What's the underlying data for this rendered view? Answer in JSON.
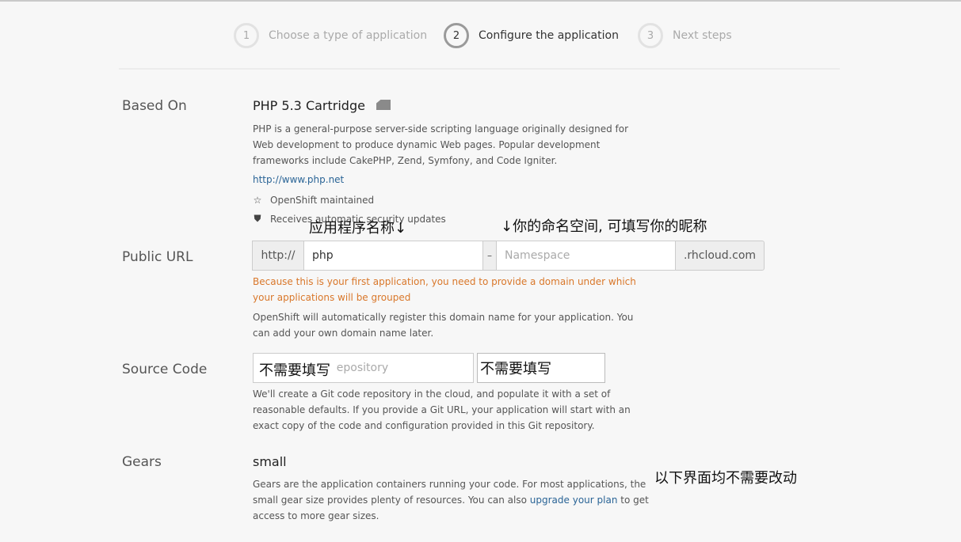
{
  "steps": [
    {
      "num": "1",
      "label": "Choose a type of application"
    },
    {
      "num": "2",
      "label": "Configure the application"
    },
    {
      "num": "3",
      "label": "Next steps"
    }
  ],
  "based_on": {
    "label": "Based On",
    "title": "PHP 5.3 Cartridge",
    "description": "PHP is a general-purpose server-side scripting language originally designed for Web development to produce dynamic Web pages. Popular development frameworks include CakePHP, Zend, Symfony, and Code Igniter.",
    "link": "http://www.php.net",
    "features": [
      "OpenShift maintained",
      "Receives automatic security updates"
    ],
    "icons": {
      "cartridge": "cartridge-icon",
      "maintained": "star-outline-icon",
      "security": "shield-icon"
    }
  },
  "public_url": {
    "label": "Public URL",
    "prefix": "http://",
    "app_name_value": "php",
    "separator": "–",
    "namespace_placeholder": "Namespace",
    "suffix": ".rhcloud.com",
    "warning": "Because this is your first application, you need to provide a domain under which your applications will be grouped",
    "help": "OpenShift will automatically register this domain name for your application. You can add your own domain name later."
  },
  "source_code": {
    "label": "Source Code",
    "repo_placeholder": "Link to a Git repository",
    "help": "We'll create a Git code repository in the cloud, and populate it with a set of reasonable defaults. If you provide a Git URL, your application will start with an exact copy of the code and configuration provided in this Git repository."
  },
  "gears": {
    "label": "Gears",
    "value": "small",
    "help_before": "Gears are the application containers running your code. For most applications, the small gear size provides plenty of resources. You can also ",
    "help_link": "upgrade your plan",
    "help_after": " to get access to more gear sizes."
  },
  "annotations": {
    "app_name": "应用程序名称↓",
    "namespace": "↓你的命名空间, 可填写你的昵称",
    "no_fill_1": "不需要填写",
    "no_fill_2": "不需要填写",
    "rest": "以下界面均不需要改动"
  },
  "colors": {
    "warning": "#d9772a",
    "link": "#2a6496",
    "background": "#f7f7f7"
  }
}
